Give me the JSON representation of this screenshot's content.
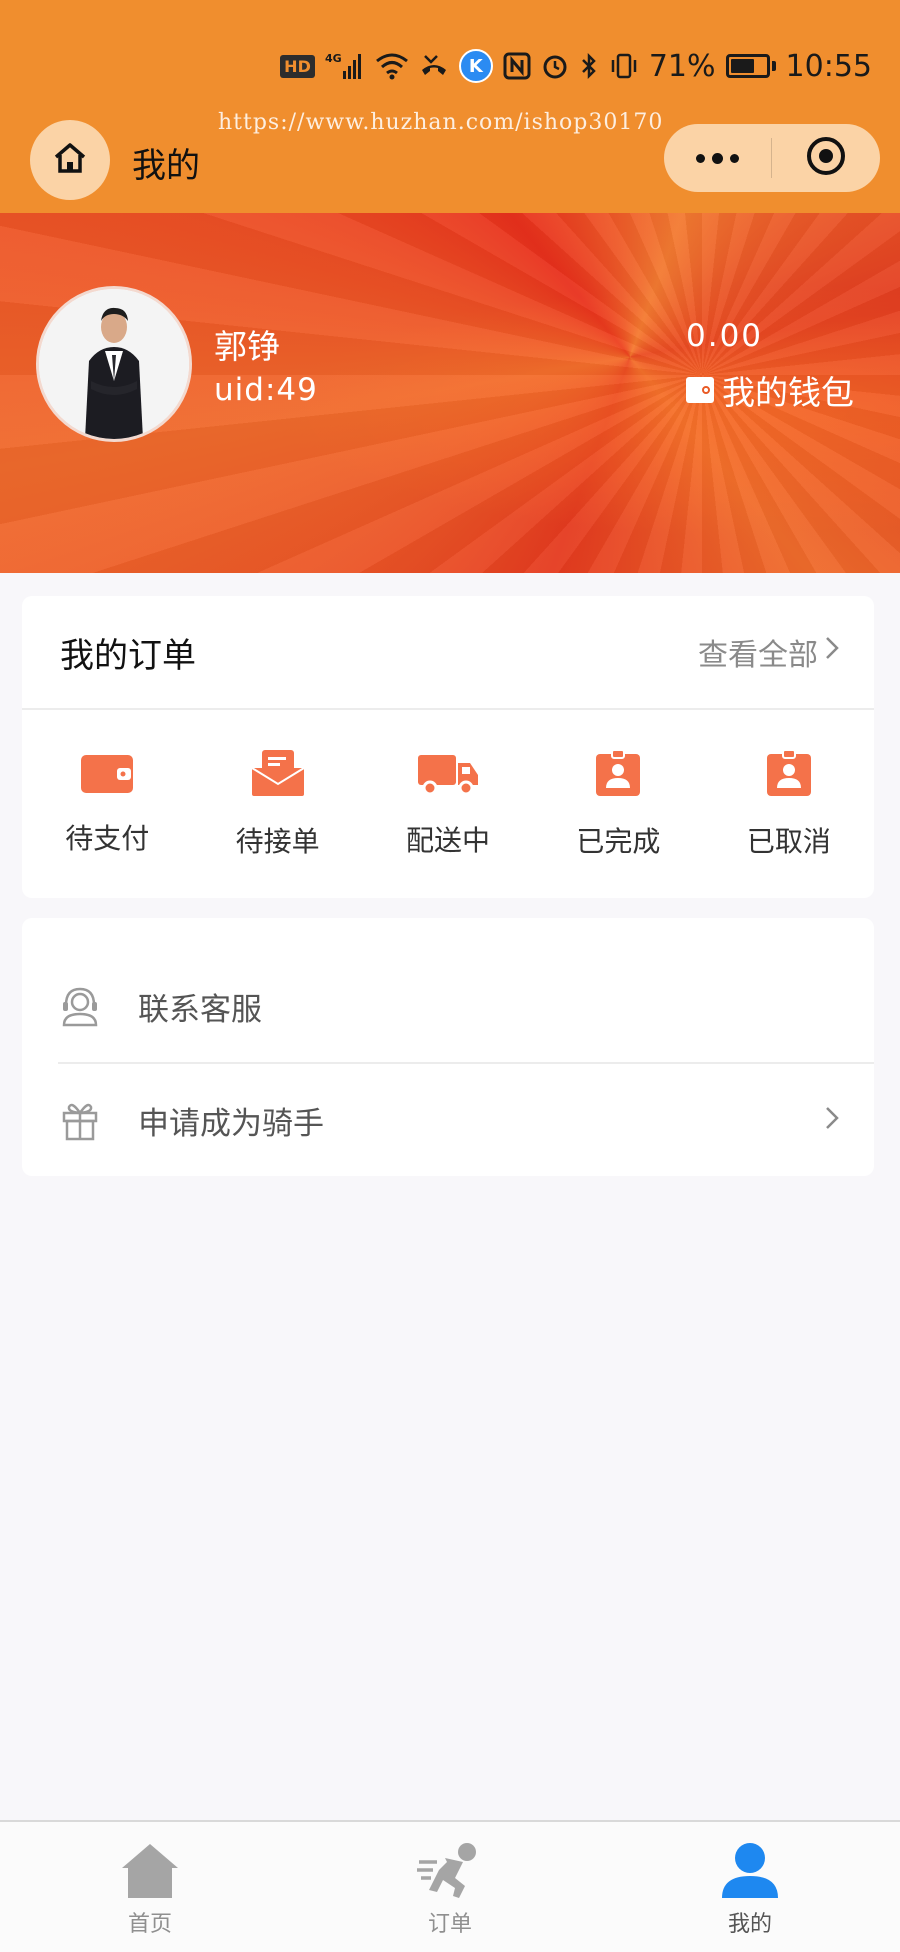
{
  "status_bar": {
    "hd_badge": "HD",
    "network": "4G",
    "k_app": "K",
    "battery": "71%",
    "battery_level": 0.71,
    "time": "10:55"
  },
  "watermark": "https://www.huzhan.com/ishop30170",
  "header": {
    "title": "我的"
  },
  "profile": {
    "name": "郭铮",
    "uid": "uid:49",
    "balance": "0.00",
    "wallet_label": "我的钱包"
  },
  "orders": {
    "title": "我的订单",
    "view_all": "查看全部",
    "items": [
      {
        "label": "待支付",
        "icon": "wallet-icon"
      },
      {
        "label": "待接单",
        "icon": "inbox-icon"
      },
      {
        "label": "配送中",
        "icon": "truck-icon"
      },
      {
        "label": "已完成",
        "icon": "badge-user-icon"
      },
      {
        "label": "已取消",
        "icon": "badge-user-icon"
      }
    ]
  },
  "menu": {
    "items": [
      {
        "label": "联系客服",
        "icon": "customer-service-icon"
      },
      {
        "label": "申请成为骑手",
        "icon": "gift-icon"
      }
    ]
  },
  "tabbar": {
    "items": [
      {
        "label": "首页",
        "icon": "home-icon"
      },
      {
        "label": "订单",
        "icon": "runner-icon"
      },
      {
        "label": "我的",
        "icon": "user-icon"
      }
    ],
    "active_index": 2
  },
  "colors": {
    "header_bg": "#f08e2e",
    "accent": "#f4724a",
    "active_tab": "#1e88f0",
    "page_bg": "#f8f7fa"
  }
}
